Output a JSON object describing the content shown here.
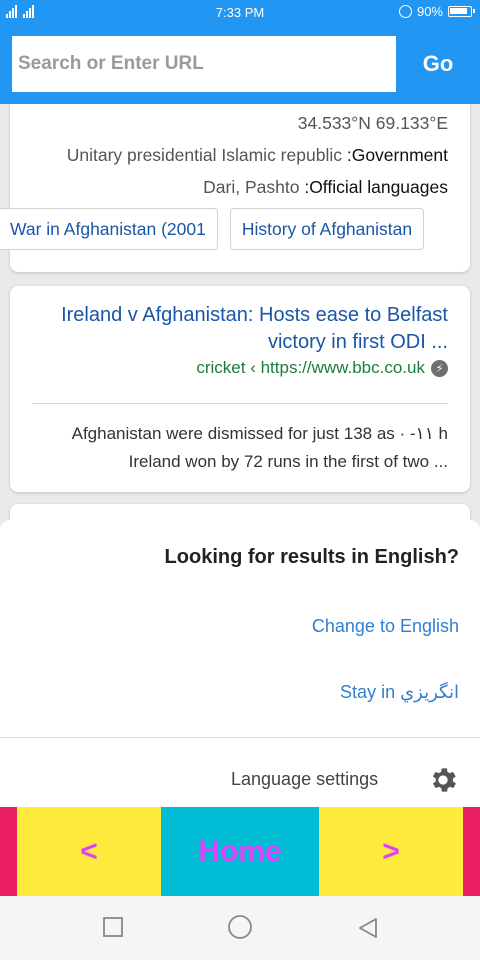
{
  "status_bar": {
    "time": "7:33 PM",
    "battery": "90%",
    "icons": [
      "signal-icon",
      "vpn-icon",
      "battery-icon"
    ]
  },
  "url_bar": {
    "placeholder": "Search or Enter URL",
    "go_label": "Go"
  },
  "info_card": {
    "coordinates": "34.533°N 69.133°E",
    "government_value": "Unitary presidential Islamic republic ",
    "government_key": ":Government",
    "languages_value": "Dari, Pashto ",
    "languages_key": ":Official languages",
    "chips": [
      "War in Afghanistan (2001",
      "History of Afghanistan"
    ]
  },
  "news_card": {
    "title": "Ireland v Afghanistan: Hosts ease to Belfast victory in first ODI ...",
    "source": "cricket ‹ https://www.bbc.co.uk",
    "snippet_line1": "Afghanistan were dismissed for just 138 as · -۱۱ h",
    "snippet_line2": "Ireland won by 72 runs in the first of two ..."
  },
  "language_popup": {
    "title": "Looking for results in English?",
    "change_label": "Change to English",
    "stay_label": "Stay in انگریزي",
    "settings_label": "Language settings"
  },
  "bottom_nav": {
    "back_label": "<",
    "home_label": "Home",
    "forward_label": ">"
  },
  "colors": {
    "primary_blue": "#2196f3",
    "link_blue": "#1a55a8",
    "source_green": "#1b7d3c",
    "nav_pink": "#e91e63",
    "nav_yellow": "#ffeb3b",
    "nav_cyan": "#00bcd4",
    "nav_text_magenta": "#e040fb"
  }
}
